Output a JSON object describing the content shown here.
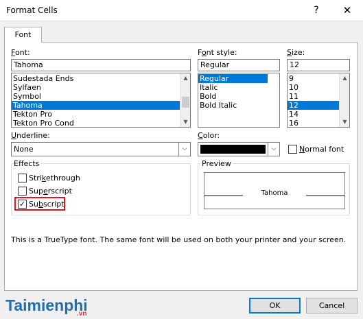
{
  "window": {
    "title": "Format Cells",
    "help_glyph": "?",
    "close_glyph": "✕"
  },
  "tabs": [
    {
      "label": "Font"
    }
  ],
  "font": {
    "label": "Font:",
    "value": "Tahoma",
    "list": [
      "Sudestada Ends",
      "Sylfaen",
      "Symbol",
      "Tahoma",
      "Tekton Pro",
      "Tekton Pro Cond"
    ],
    "selected_index": 3
  },
  "font_style": {
    "label": "Font style:",
    "value": "Regular",
    "list": [
      "Regular",
      "Italic",
      "Bold",
      "Bold Italic"
    ],
    "selected_index": 0
  },
  "size": {
    "label": "Size:",
    "value": "12",
    "list": [
      "9",
      "10",
      "11",
      "12",
      "14",
      "16"
    ],
    "selected_index": 3
  },
  "underline": {
    "label": "Underline:",
    "value": "None"
  },
  "color": {
    "label": "Color:",
    "swatch": "#000000",
    "normal_font_label": "Normal font",
    "normal_font_checked": false
  },
  "effects": {
    "title": "Effects",
    "strikethrough": {
      "label": "Strikethrough",
      "checked": false
    },
    "superscript": {
      "label": "Superscript",
      "checked": false
    },
    "subscript": {
      "label": "Subscript",
      "checked": true
    }
  },
  "preview": {
    "title": "Preview",
    "sample_text": "Tahoma"
  },
  "info_text": "This is a TrueType font.  The same font will be used on both your printer and your screen.",
  "buttons": {
    "ok": "OK",
    "cancel": "Cancel"
  },
  "watermark": {
    "brand": "Taimienphi",
    "suffix": ".vn"
  },
  "colors": {
    "selection": "#0078d7",
    "highlight_box": "#e81123",
    "watermark_blue": "#1f6fb5",
    "watermark_red": "#e53935"
  }
}
